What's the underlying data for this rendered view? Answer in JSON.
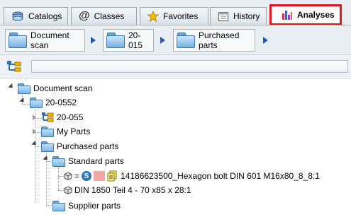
{
  "tabs": [
    {
      "label": "Catalogs",
      "icon": "catalogs-icon"
    },
    {
      "label": "Classes",
      "icon": "at-icon"
    },
    {
      "label": "Favorites",
      "icon": "star-icon"
    },
    {
      "label": "History",
      "icon": "history-icon"
    },
    {
      "label": "Analyses",
      "icon": "bar-chart-icon",
      "active": true
    }
  ],
  "breadcrumb": [
    {
      "label": "Document scan"
    },
    {
      "label": "20-015"
    },
    {
      "label": "Purchased parts"
    }
  ],
  "tree": {
    "root": "Document scan",
    "n1": "20-0552",
    "n2": "20-055",
    "n3": "My Parts",
    "n4": "Purchased parts",
    "n5": "Standard parts",
    "n6_eq": "=",
    "n6_s": "S",
    "n6": "14186623500_Hexagon bolt  DIN 601 M16x80_8_8:1",
    "n7": "DIN 1850 Teil 4 - 70 x85 x 28:1",
    "n8": "Supplier parts"
  },
  "colors": {
    "active_tab_border": "#e0161f",
    "folder": "#7bb6e5",
    "link_blue": "#2c5aa0"
  }
}
